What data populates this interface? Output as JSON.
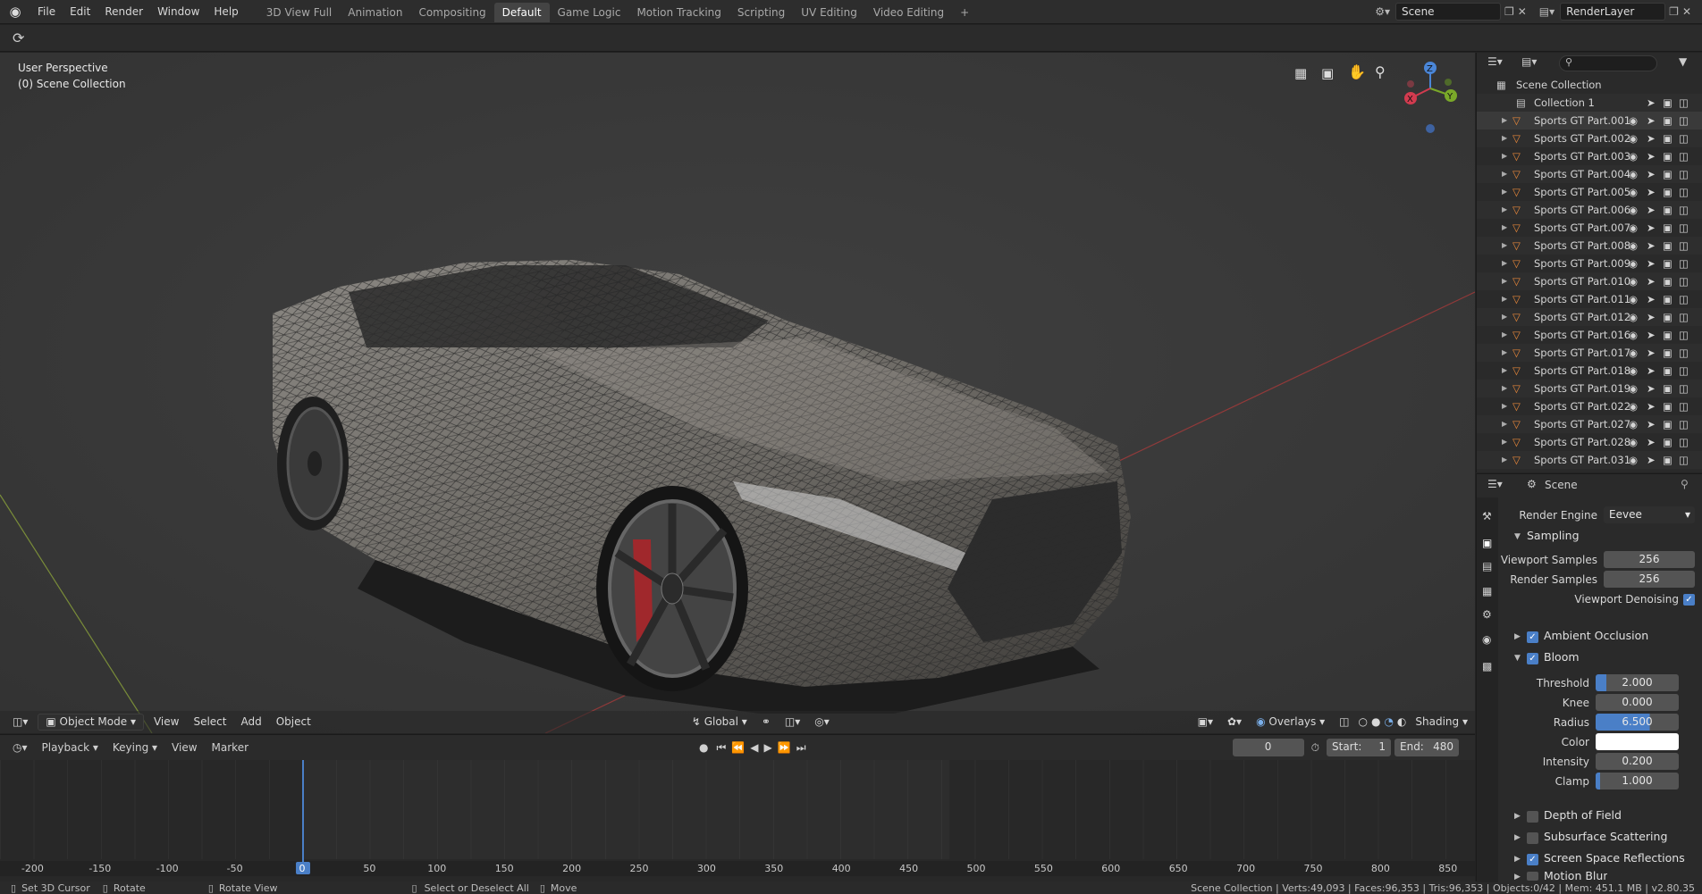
{
  "topbar": {
    "menu": [
      "File",
      "Edit",
      "Render",
      "Window",
      "Help"
    ],
    "workspaces": [
      {
        "label": "3D View Full",
        "active": false
      },
      {
        "label": "Animation",
        "active": false
      },
      {
        "label": "Compositing",
        "active": false
      },
      {
        "label": "Default",
        "active": true
      },
      {
        "label": "Game Logic",
        "active": false
      },
      {
        "label": "Motion Tracking",
        "active": false
      },
      {
        "label": "Scripting",
        "active": false
      },
      {
        "label": "UV Editing",
        "active": false
      },
      {
        "label": "Video Editing",
        "active": false
      }
    ],
    "add_tab": "+",
    "scene_name": "Scene",
    "render_layer": "RenderLayer"
  },
  "viewport": {
    "perspective": "User Perspective",
    "collection": "(0) Scene Collection",
    "header": {
      "mode": "Object Mode",
      "view": "View",
      "select": "Select",
      "add": "Add",
      "object": "Object",
      "transform": "Global",
      "overlays": "Overlays",
      "shading": "Shading"
    },
    "gizmo": {
      "x": "X",
      "y": "Y",
      "z": "Z"
    }
  },
  "timeline": {
    "playback": "Playback",
    "keying": "Keying",
    "view": "View",
    "marker": "Marker",
    "current_frame": "0",
    "start_label": "Start:",
    "start": "1",
    "end_label": "End:",
    "end": "480",
    "ruler": [
      "-200",
      "-150",
      "-100",
      "-50",
      "0",
      "50",
      "100",
      "150",
      "200",
      "250",
      "300",
      "350",
      "400",
      "450",
      "500",
      "550",
      "600",
      "650",
      "700",
      "750",
      "800",
      "850"
    ]
  },
  "outliner": {
    "root": "Scene Collection",
    "collection": "Collection 1",
    "objects": [
      "Sports GT Part.001",
      "Sports GT Part.002",
      "Sports GT Part.003",
      "Sports GT Part.004",
      "Sports GT Part.005",
      "Sports GT Part.006",
      "Sports GT Part.007",
      "Sports GT Part.008",
      "Sports GT Part.009",
      "Sports GT Part.010",
      "Sports GT Part.011",
      "Sports GT Part.012",
      "Sports GT Part.016",
      "Sports GT Part.017",
      "Sports GT Part.018",
      "Sports GT Part.019",
      "Sports GT Part.022",
      "Sports GT Part.027",
      "Sports GT Part.028",
      "Sports GT Part.031"
    ]
  },
  "properties": {
    "context": "Scene",
    "render_engine_label": "Render Engine",
    "render_engine": "Eevee",
    "sampling": "Sampling",
    "viewport_samples_label": "Viewport Samples",
    "viewport_samples": "256",
    "render_samples_label": "Render Samples",
    "render_samples": "256",
    "viewport_denoising": "Viewport Denoising",
    "ambient_occlusion": "Ambient Occlusion",
    "bloom": "Bloom",
    "threshold_label": "Threshold",
    "threshold": "2.000",
    "knee_label": "Knee",
    "knee": "0.000",
    "radius_label": "Radius",
    "radius": "6.500",
    "color_label": "Color",
    "intensity_label": "Intensity",
    "intensity": "0.200",
    "clamp_label": "Clamp",
    "clamp": "1.000",
    "depth_of_field": "Depth of Field",
    "subsurface_scattering": "Subsurface Scattering",
    "screen_space_reflections": "Screen Space Reflections",
    "motion_blur": "Motion Blur"
  },
  "statusbar": {
    "set_cursor": "Set 3D Cursor",
    "rotate": "Rotate",
    "rotate_view": "Rotate View",
    "select": "Select or Deselect All",
    "move": "Move",
    "stats": "Scene Collection | Verts:49,093 | Faces:96,353 | Tris:96,353 | Objects:0/42 | Mem: 451.1 MB | v2.80.35"
  },
  "colors": {
    "accent": "#4a7fc7",
    "active_tab": "#444444",
    "object_icon": "#e8883a"
  }
}
